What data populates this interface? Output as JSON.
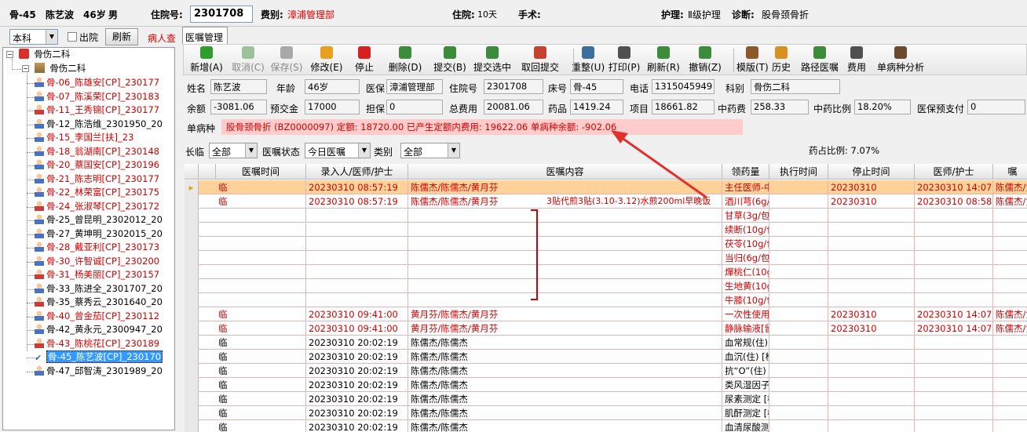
{
  "header": {
    "bed": "骨-45",
    "name": "陈艺波",
    "age": "46岁",
    "sex": "男",
    "admission_label": "住院号:",
    "admission_no": "2301708",
    "fee_type_label": "费别:",
    "fee_type": "漳浦管理部",
    "stay_label": "住院:",
    "stay": "10天",
    "surgery_label": "手术:",
    "nursing_label": "护理:",
    "nursing": "Ⅱ级护理",
    "diagnosis_label": "诊断:",
    "diagnosis": "股骨颈骨折"
  },
  "left": {
    "dept_select": "本科",
    "discharge_label": "出院",
    "refresh_label": "刷新",
    "nav_link": "病人查",
    "tree_root": "骨伤二科",
    "tree_group": "骨伤二科",
    "patients": [
      {
        "label": "骨-06_陈雄安[CP]_230177",
        "red": true,
        "female": false
      },
      {
        "label": "骨-07_陈溪荣[CP]_230183",
        "red": true,
        "female": false
      },
      {
        "label": "骨-11_王秀锦[CP]_230177",
        "red": true,
        "female": true
      },
      {
        "label": "骨-12_陈浩维_2301950_20",
        "red": false,
        "female": false
      },
      {
        "label": "骨-15_李国兰[扶]_23",
        "red": true,
        "female": false
      },
      {
        "label": "骨-18_翁湖南[CP]_230148",
        "red": true,
        "female": false
      },
      {
        "label": "骨-20_蔡国安[CP]_230196",
        "red": true,
        "female": false
      },
      {
        "label": "骨-21_陈志明[CP]_230177",
        "red": true,
        "female": false
      },
      {
        "label": "骨-22_林荣富[CP]_230175",
        "red": true,
        "female": false
      },
      {
        "label": "骨-24_张淑琴[CP]_230172",
        "red": true,
        "female": true
      },
      {
        "label": "骨-25_曾昆明_2302012_20",
        "red": false,
        "female": false
      },
      {
        "label": "骨-27_黄坤明_2302015_20",
        "red": false,
        "female": false
      },
      {
        "label": "骨-28_戴亚利[CP]_230173",
        "red": true,
        "female": false
      },
      {
        "label": "骨-30_许智诚[CP]_230200",
        "red": true,
        "female": false
      },
      {
        "label": "骨-31_杨美丽[CP]_230157",
        "red": true,
        "female": true
      },
      {
        "label": "骨-33_陈进全_2301707_20",
        "red": false,
        "female": false
      },
      {
        "label": "骨-35_蔡秀云_2301640_20",
        "red": false,
        "female": true
      },
      {
        "label": "骨-40_曾金茄[CP]_230112",
        "red": true,
        "female": false
      },
      {
        "label": "骨-42_黄永元_2300947_20",
        "red": false,
        "female": false
      },
      {
        "label": "骨-43_陈桃花[CP]_230189",
        "red": true,
        "female": true
      },
      {
        "label": "骨-45_陈艺波[CP]_230170",
        "red": true,
        "female": false,
        "selected": true
      },
      {
        "label": "骨-47_邱智涛_2301989_20",
        "red": false,
        "female": false
      }
    ]
  },
  "main": {
    "tab": "医嘱管理",
    "toolbar": [
      {
        "label": "新增(A)",
        "disabled": false,
        "color": "#2e9e2e"
      },
      {
        "label": "取消(C)",
        "disabled": true,
        "color": "#9cc29c"
      },
      {
        "label": "保存(S)",
        "disabled": true,
        "color": "#a8a8a8"
      },
      {
        "label": "修改(E)",
        "disabled": false,
        "color": "#e8a020"
      },
      {
        "label": "停止",
        "disabled": false,
        "color": "#d82020"
      },
      {
        "label": "删除(D)",
        "disabled": false,
        "color": "#3c8c3c"
      },
      {
        "label": "提交(B)",
        "disabled": false,
        "color": "#3c8c3c"
      },
      {
        "label": "提交选中",
        "disabled": false,
        "color": "#3c8c3c"
      },
      {
        "label": "取回提交",
        "disabled": false,
        "color": "#c84030"
      },
      {
        "label": "重整(U)",
        "disabled": false,
        "color": "#3c6e9e"
      },
      {
        "label": "打印(P)",
        "disabled": false,
        "color": "#505050"
      },
      {
        "label": "刷新(R)",
        "disabled": false,
        "color": "#3c8c3c"
      },
      {
        "label": "撤销(Z)",
        "disabled": false,
        "color": "#3c8c3c"
      },
      {
        "label": "模版(T)",
        "disabled": false,
        "color": "#8c5a2a"
      },
      {
        "label": "历史",
        "disabled": false,
        "color": "#d89020"
      },
      {
        "label": "路径医嘱",
        "disabled": false,
        "color": "#3c8c3c"
      },
      {
        "label": "费用",
        "disabled": false,
        "color": "#505050"
      },
      {
        "label": "单病种分析",
        "disabled": false,
        "color": "#6a4a2a"
      }
    ],
    "info": {
      "name_label": "姓名",
      "name": "陈艺波",
      "age_label": "年龄",
      "age": "46岁",
      "insurance_label": "医保",
      "insurance": "漳浦管理部",
      "admission_label": "住院号",
      "admission": "2301708",
      "bed_label": "床号",
      "bed": "骨-45",
      "phone_label": "电话",
      "phone": "1315045949",
      "dept_label": "科别",
      "dept": "骨伤二科",
      "balance_label": "余额",
      "balance": "-3081.06",
      "deposit_label": "预交金",
      "deposit": "17000",
      "guarantee_label": "担保",
      "guarantee": "0",
      "total_label": "总费用",
      "total": "20081.06",
      "drug_label": "药品",
      "drug": "1419.24",
      "item_label": "项目",
      "item": "18661.82",
      "tcm_label": "中药费",
      "tcm": "258.33",
      "tcm_ratio_label": "中药比例",
      "tcm_ratio": "18.20%",
      "ins_prepay_label": "医保预支付",
      "ins_prepay": "0",
      "disease_label": "单病种",
      "disease_text": "股骨颈骨折 (BZ0000097)  定额: 18720.00  已产生定额内费用: 19622.06  单病种余额: -902.06"
    },
    "filters": {
      "type_label": "长临",
      "type": "全部",
      "status_label": "医嘱状态",
      "status": "今日医嘱",
      "category_label": "类别",
      "category": "全部",
      "drug_ratio": "药占比例: 7.07%"
    },
    "columns": [
      "医嘱时间",
      "录入人/医师/护士",
      "医嘱内容",
      "领药量",
      "执行时间",
      "停止时间",
      "医师/护士",
      "嘱"
    ],
    "rows": [
      {
        "t": "临",
        "time": "20230310 08:57:19",
        "who": "陈儒杰/陈儒杰/黄月芬",
        "content": "主任医师-中医辨证论治   [骨伤二科]",
        "qty": "",
        "exec": "20230310",
        "stop": "20230310 14:07:00",
        "doc": "陈儒杰/黄月芬",
        "red": true,
        "hl": true
      },
      {
        "t": "临",
        "time": "20230310 08:57:19",
        "who": "陈儒杰/陈儒杰/黄月芬",
        "content": "酒川芎(6g/包)[1000g]6g",
        "qty": "",
        "exec": "20230310",
        "stop": "20230310 08:58:00",
        "doc": "陈儒杰/黄月芬",
        "red": true,
        "note": "3贴代煎3贴(3.10-3.12)水煎200ml早晚饭"
      },
      {
        "t": "",
        "time": "",
        "who": "",
        "content": "甘草(3g/包)[3g/包]3g",
        "red": true
      },
      {
        "t": "",
        "time": "",
        "who": "",
        "content": "续断(10g/包)[1000g]10g",
        "red": true
      },
      {
        "t": "",
        "time": "",
        "who": "",
        "content": "茯苓(10g/包)[1000g]10g",
        "red": true
      },
      {
        "t": "",
        "time": "",
        "who": "",
        "content": "当归(6g/包)[1000g]6g",
        "red": true
      },
      {
        "t": "",
        "time": "",
        "who": "",
        "content": "燀桃仁(10g/包)[1000g]10g",
        "red": true
      },
      {
        "t": "",
        "time": "",
        "who": "",
        "content": "生地黄(10g/包)[10g/包]10g",
        "red": true
      },
      {
        "t": "",
        "time": "",
        "who": "",
        "content": "牛膝(10g/包)[1000g]10g",
        "red": true
      },
      {
        "t": "临",
        "time": "20230310 09:41:00",
        "who": "黄月芬/陈儒杰/黄月芬",
        "content": "一次性使用静脉留置针(Y-G)   [骨伤二科]",
        "qty": "",
        "exec": "20230310",
        "stop": "20230310 14:07:00",
        "doc": "陈儒杰/黄月芬",
        "red": true
      },
      {
        "t": "临",
        "time": "20230310 09:41:00",
        "who": "黄月芬/陈儒杰/黄月芬",
        "content": "静脉输液[留置静脉针]   [骨伤二科]",
        "qty": "",
        "exec": "20230310",
        "stop": "20230310 14:07:00",
        "doc": "陈儒杰/黄月芬",
        "red": true
      },
      {
        "t": "临",
        "time": "20230310 20:02:19",
        "who": "陈儒杰/陈儒杰",
        "content": "血常规(住)   [检验科]",
        "red": false
      },
      {
        "t": "临",
        "time": "20230310 20:02:19",
        "who": "陈儒杰/陈儒杰",
        "content": "血沉(住)   [检验科]",
        "red": false
      },
      {
        "t": "临",
        "time": "20230310 20:02:19",
        "who": "陈儒杰/陈儒杰",
        "content": "抗“O”(住)   [检验科]",
        "red": false
      },
      {
        "t": "临",
        "time": "20230310 20:02:19",
        "who": "陈儒杰/陈儒杰",
        "content": "类风湿因子(RF)测定   [检验科]",
        "red": false
      },
      {
        "t": "临",
        "time": "20230310 20:02:19",
        "who": "陈儒杰/陈儒杰",
        "content": "尿素测定   [检验科]",
        "red": false
      },
      {
        "t": "临",
        "time": "20230310 20:02:19",
        "who": "陈儒杰/陈儒杰",
        "content": "肌酐测定   [检验科]",
        "red": false
      },
      {
        "t": "临",
        "time": "20230310 20:02:19",
        "who": "陈儒杰/陈儒杰",
        "content": "血清尿酸测定   [检验科]",
        "red": false
      }
    ]
  }
}
